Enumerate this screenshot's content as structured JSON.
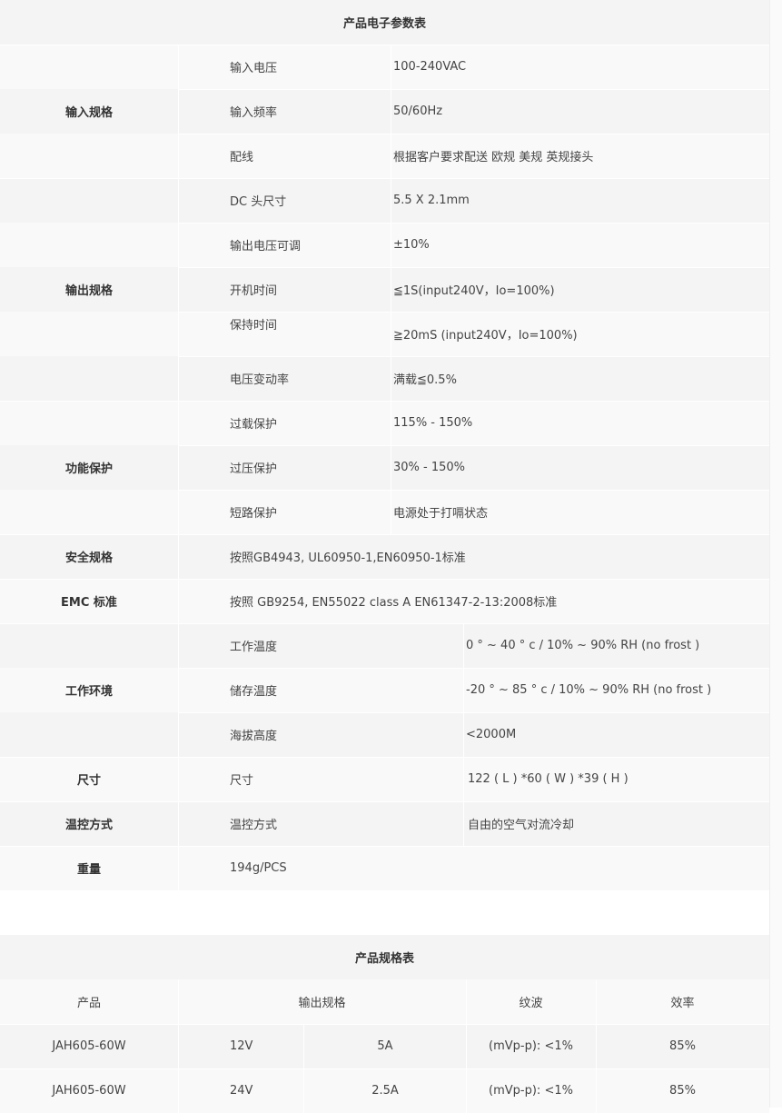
{
  "table1": {
    "title": "产品电子参数表",
    "groups": [
      {
        "name": "输入规格",
        "rows": [
          {
            "label": "输入电压",
            "value": "100-240VAC"
          },
          {
            "label": "输入频率",
            "value": "50/60Hz"
          },
          {
            "label": "配线",
            "value": "根据客户要求配送 欧规 美规 英规接头"
          }
        ]
      },
      {
        "name": "输出规格",
        "rows": [
          {
            "label": "DC 头尺寸",
            "value": " 5.5 X 2.1mm"
          },
          {
            "label": "输出电压可调",
            "value": "±10%"
          },
          {
            "label": "开机时间",
            "value": "≦1S(input240V，Io=100%)"
          },
          {
            "label": "保持时间",
            "value": "≧20mS (input240V，Io=100%)"
          },
          {
            "label": "电压变动率",
            "value": "满载≦0.5%"
          }
        ]
      },
      {
        "name": "功能保护",
        "rows": [
          {
            "label": "过载保护",
            "value": "115% - 150%"
          },
          {
            "label": "过压保护",
            "value": "30% - 150%"
          },
          {
            "label": "短路保护",
            "value": "电源处于打嗝状态"
          }
        ]
      },
      {
        "name": "安全规格",
        "value": "按照GB4943, UL60950-1,EN60950-1标准"
      },
      {
        "name": "EMC 标准",
        "value": "按照 GB9254, EN55022 class A EN61347-2-13:2008标准"
      },
      {
        "name": "工作环境",
        "rows": [
          {
            "label": "工作温度",
            "value": "0 ° ~ 40 ° c / 10% ~ 90% RH (no frost )"
          },
          {
            "label": "储存温度",
            "value": "-20 ° ~ 85 ° c / 10% ~ 90% RH (no frost )"
          },
          {
            "label": "海拔高度",
            "value": "<2000M"
          }
        ]
      },
      {
        "name": "尺寸",
        "label": "尺寸",
        "value": "122 ( L ) *60 ( W ) *39 ( H )"
      },
      {
        "name": "温控方式",
        "label": "温控方式",
        "value": "自由的空气对流冷却"
      },
      {
        "name": "重量",
        "value": "194g/PCS"
      }
    ]
  },
  "table2": {
    "title": "产品规格表",
    "headers": [
      "产品",
      "输出规格",
      "纹波",
      "效率"
    ],
    "rows": [
      {
        "product": "JAH605-60W",
        "voltage": "12V",
        "current": "5A",
        "ripple": "(mVp-p): <1%",
        "efficiency": "85%"
      },
      {
        "product": "JAH605-60W",
        "voltage": "24V",
        "current": "2.5A",
        "ripple": "(mVp-p): <1%",
        "efficiency": "85%"
      }
    ]
  }
}
